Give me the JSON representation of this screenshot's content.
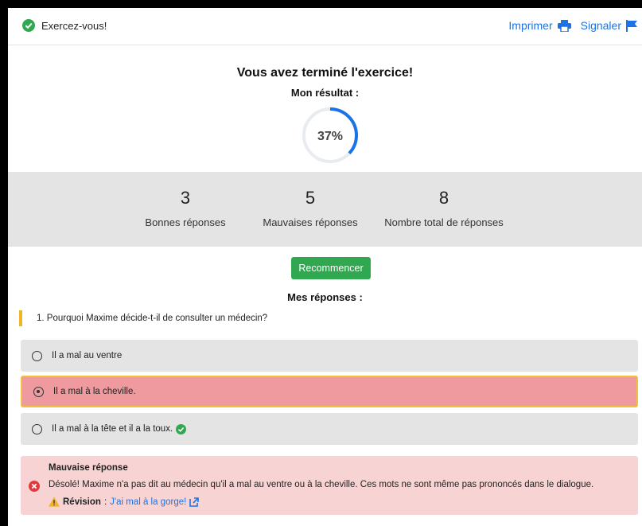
{
  "header": {
    "title": "Exercez-vous!",
    "print_label": "Imprimer",
    "report_label": "Signaler"
  },
  "result": {
    "heading": "Vous avez terminé l'exercice!",
    "subheading": "Mon résultat :",
    "percent_text": "37%",
    "percent_value": 0.37,
    "progress_color": "#1a73e8"
  },
  "stats": [
    {
      "value": "3",
      "label": "Bonnes réponses"
    },
    {
      "value": "5",
      "label": "Mauvaises réponses"
    },
    {
      "value": "8",
      "label": "Nombre total de réponses"
    }
  ],
  "restart_label": "Recommencer",
  "answers": {
    "title": "Mes réponses :",
    "question": "1. Pourquoi Maxime décide-t-il de consulter un médecin?",
    "options": [
      {
        "text": "Il a mal au ventre",
        "selected": false,
        "correct": false
      },
      {
        "text": "Il a mal à la cheville.",
        "selected": true,
        "correct": false
      },
      {
        "text": "Il a mal à la tête et il a la toux.",
        "selected": false,
        "correct": true
      }
    ]
  },
  "feedback": {
    "title": "Mauvaise réponse",
    "message": "Désolé! Maxime n'a pas dit au médecin qu'il a mal au ventre ou à la cheville. Ces mots ne sont même pas prononcés dans le dialogue.",
    "revision_label": "Révision",
    "revision_sep": ":",
    "revision_link": "J'ai mal à la gorge!"
  },
  "colors": {
    "accent": "#1a73e8",
    "success": "#2fa84f",
    "error": "#e03a3e",
    "warning": "#f0b429"
  }
}
